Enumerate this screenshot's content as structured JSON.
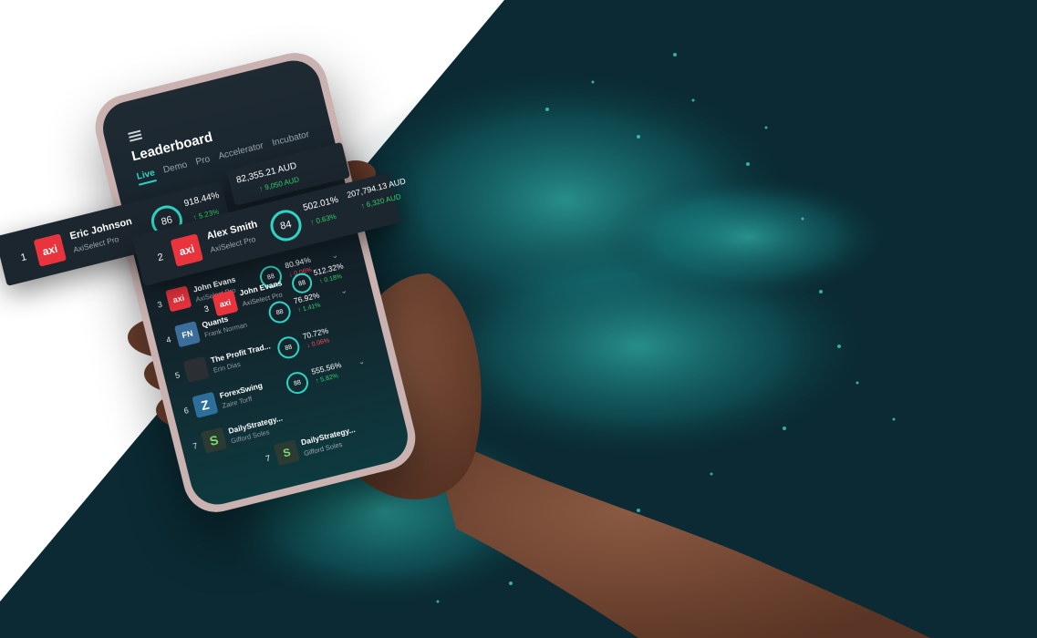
{
  "leaderboard": {
    "title": "Leaderboard",
    "tabs": [
      {
        "label": "Live",
        "active": true
      },
      {
        "label": "Demo"
      },
      {
        "label": "Pro"
      },
      {
        "label": "Accelerator"
      },
      {
        "label": "Incubator"
      }
    ],
    "card1": {
      "rank": "1",
      "logo": "axi",
      "name": "Eric Johnson",
      "sub": "AxiSelect Pro",
      "score": "86",
      "pct": "918.44%",
      "chg": "↑ 5.23%",
      "amount": "82,355.21 AUD",
      "amount_chg": "↑ 9,050 AUD"
    },
    "card2": {
      "rank": "2",
      "logo": "axi",
      "name": "Alex Smith",
      "sub": "AxiSelect Pro",
      "score": "84",
      "pct": "502.01%",
      "chg": "↑ 0.63%",
      "amount": "207,794.13 AUD",
      "amount_chg": "↑ 6,320 AUD"
    },
    "rows": [
      {
        "rank": "3",
        "avatar": "axi",
        "name": "John Evans",
        "sub": "AxiSelect Pro",
        "score": "88",
        "pct": "512.32%",
        "chg": "↑ 0.18%",
        "dir": "up"
      },
      {
        "rank": "3",
        "avatar": "axi",
        "name": "John Evans",
        "sub": "AxiSelect Pro",
        "score": "88",
        "pct": "80.94%",
        "chg": "↓ 0.06%",
        "dir": "down"
      },
      {
        "rank": "4",
        "avatar": "FN",
        "name": "Quants",
        "sub": "Frank Norman",
        "score": "88",
        "pct": "76.92%",
        "chg": "↑ 1.41%",
        "dir": "up"
      },
      {
        "rank": "5",
        "avatar": "",
        "name": "The Profit Trad...",
        "sub": "Erin Dias",
        "score": "88",
        "pct": "70.72%",
        "chg": "↓ 0.06%",
        "dir": "down"
      },
      {
        "rank": "6",
        "avatar": "Z",
        "name": "ForexSwing",
        "sub": "Zaire Torff",
        "score": "88",
        "pct": "555.56%",
        "chg": "↑ 5.82%",
        "dir": "up"
      },
      {
        "rank": "7",
        "avatar": "S",
        "name": "DailyStrategy...",
        "sub": "Gifford Soles",
        "score": "",
        "pct": "",
        "chg": "",
        "dir": "up"
      }
    ]
  },
  "colors": {
    "background_dark": "#0b2a33",
    "accent_teal": "#2ed3c3",
    "brand_red": "#e9343e",
    "up_green": "#2fd06b",
    "down_red": "#ff4a5a"
  }
}
